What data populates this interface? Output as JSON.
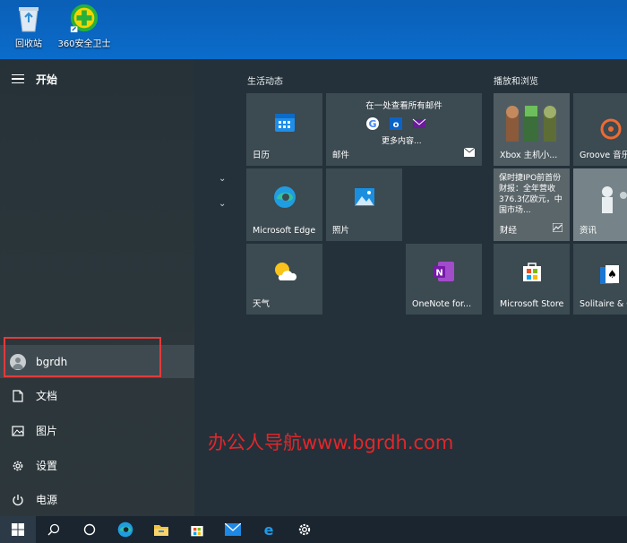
{
  "desktop": {
    "icons": [
      {
        "label": "回收站",
        "icon": "recycle-bin-icon"
      },
      {
        "label": "360安全卫士",
        "icon": "360-shield-icon"
      }
    ]
  },
  "start_menu": {
    "title": "开始",
    "user": "bgrdh",
    "rail_items": [
      {
        "label": "文档",
        "icon": "document-icon"
      },
      {
        "label": "图片",
        "icon": "picture-icon"
      },
      {
        "label": "设置",
        "icon": "gear-icon"
      },
      {
        "label": "电源",
        "icon": "power-icon"
      }
    ],
    "groups": {
      "left": "生活动态",
      "right": "播放和浏览"
    },
    "tiles": {
      "calendar": "日历",
      "mail_header": "在一处查看所有邮件",
      "mail_more": "更多内容...",
      "mail": "邮件",
      "edge": "Microsoft Edge",
      "photos": "照片",
      "weather": "天气",
      "onenote": "OneNote for...",
      "xbox": "Xbox 主机小...",
      "groove": "Groove 音乐",
      "finance_headline": "保时捷IPO前首份财报：全年营收376.3亿欧元，中国市场...",
      "finance": "财经",
      "news": "资讯",
      "store": "Microsoft Store",
      "solitaire": "Solitaire & C"
    }
  },
  "watermark": "办公人导航www.bgrdh.com",
  "colors": {
    "accent": "#0078d7",
    "highlight": "#e23b3b",
    "tile": "#3c4a51",
    "taskbar": "#1b2530"
  },
  "taskbar": [
    {
      "icon": "windows-start-icon"
    },
    {
      "icon": "search-icon"
    },
    {
      "icon": "task-view-icon"
    },
    {
      "icon": "edge-icon"
    },
    {
      "icon": "file-explorer-icon"
    },
    {
      "icon": "store-icon"
    },
    {
      "icon": "mail-icon"
    },
    {
      "icon": "ie-icon"
    },
    {
      "icon": "settings-icon"
    }
  ]
}
